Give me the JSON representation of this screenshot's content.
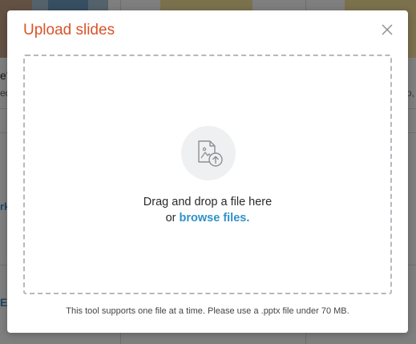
{
  "background": {
    "fragment_top": "e'",
    "fragment_sub": "ed",
    "fragment_right": "o,",
    "fragment_link": "rk",
    "fragment_bottom_link": "E"
  },
  "modal": {
    "title": "Upload slides",
    "close_icon": "close-icon",
    "dropzone": {
      "icon": "image-upload-icon",
      "line1": "Drag and drop a file here",
      "line2_prefix": "or ",
      "browse_label": "browse files."
    },
    "footnote": "This tool supports one file at a time. Please use a .pptx file under 70 MB."
  },
  "colors": {
    "title": "#d9532a",
    "link": "#3192c8",
    "dropzone_border": "#b4b8bf"
  }
}
